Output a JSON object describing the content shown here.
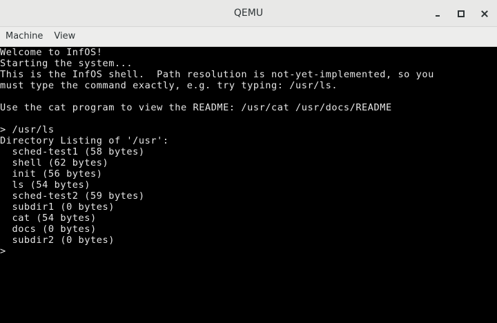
{
  "window": {
    "title": "QEMU",
    "controls": {
      "minimize_icon": "minimize-icon",
      "maximize_icon": "maximize-icon",
      "close_icon": "close-icon"
    }
  },
  "menubar": {
    "items": [
      {
        "label": "Machine"
      },
      {
        "label": "View"
      }
    ]
  },
  "console": {
    "lines": [
      "Welcome to InfOS!",
      "Starting the system...",
      "This is the InfOS shell.  Path resolution is not-yet-implemented, so you",
      "must type the command exactly, e.g. try typing: /usr/ls.",
      "",
      "Use the cat program to view the README: /usr/cat /usr/docs/README",
      "",
      "> /usr/ls",
      "Directory Listing of '/usr':",
      "  sched-test1 (58 bytes)",
      "  shell (62 bytes)",
      "  init (56 bytes)",
      "  ls (54 bytes)",
      "  sched-test2 (59 bytes)",
      "  subdir1 (0 bytes)",
      "  cat (54 bytes)",
      "  docs (0 bytes)",
      "  subdir2 (0 bytes)",
      ">"
    ]
  },
  "colors": {
    "console_bg": "#000000",
    "console_fg": "#e6e6e6",
    "titlebar_bg": "#e8e8e7",
    "menubar_bg": "#ededec"
  }
}
